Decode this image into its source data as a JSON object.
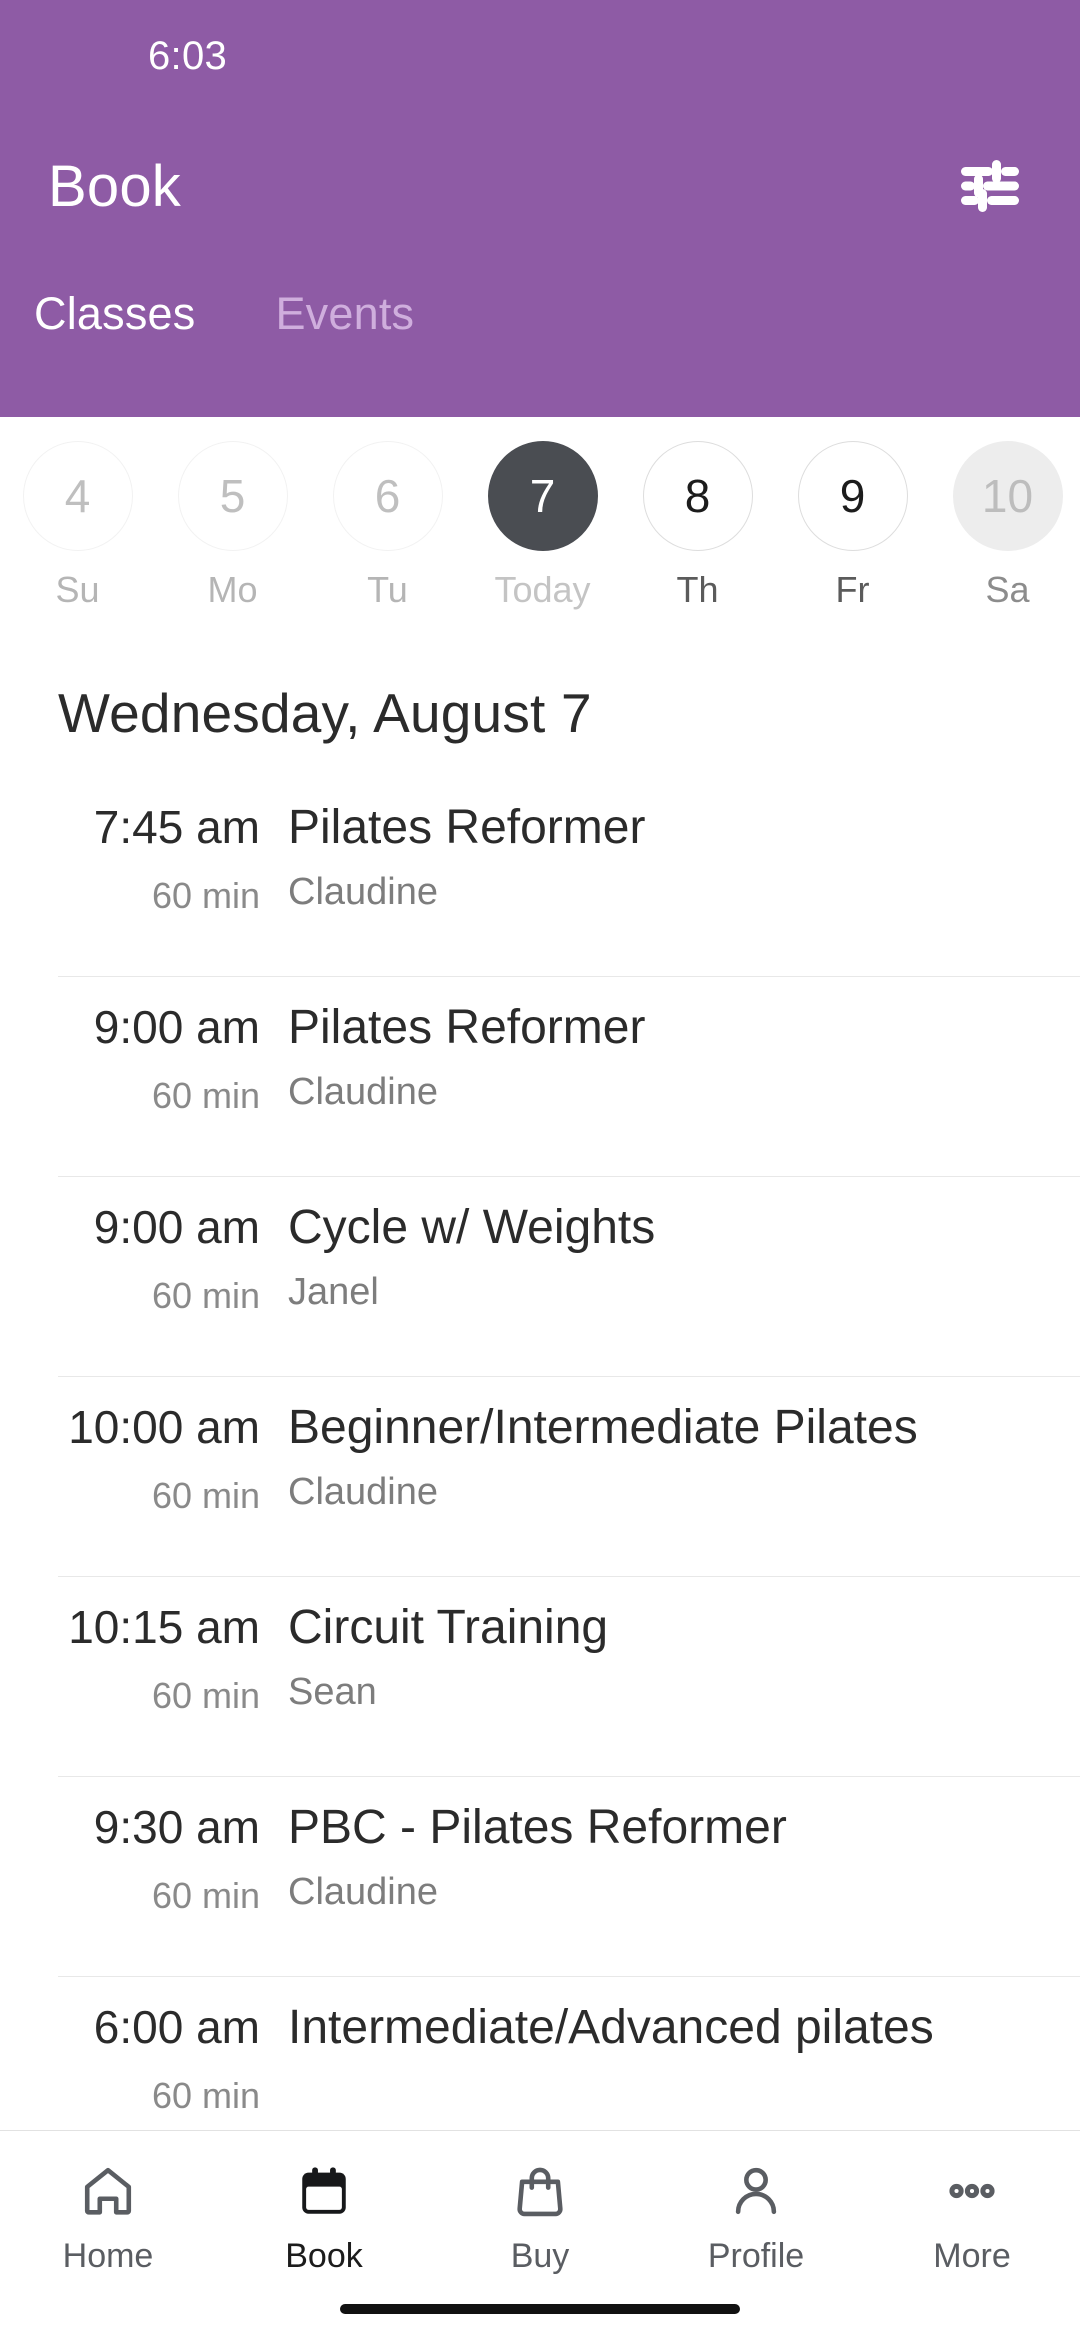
{
  "status_bar": {
    "time": "6:03"
  },
  "header": {
    "title": "Book",
    "filter_icon": "sliders-filter-icon",
    "accent_color": "#8E5BA5",
    "tabs": [
      {
        "label": "Classes",
        "active": true
      },
      {
        "label": "Events",
        "active": false
      }
    ]
  },
  "date_strip": {
    "days": [
      {
        "num": "4",
        "weekday": "Su",
        "state": "past"
      },
      {
        "num": "5",
        "weekday": "Mo",
        "state": "past"
      },
      {
        "num": "6",
        "weekday": "Tu",
        "state": "past"
      },
      {
        "num": "7",
        "weekday": "Today",
        "state": "selected"
      },
      {
        "num": "8",
        "weekday": "Th",
        "state": "future"
      },
      {
        "num": "9",
        "weekday": "Fr",
        "state": "future"
      },
      {
        "num": "10",
        "weekday": "Sa",
        "state": "faded"
      }
    ],
    "selected_color": "#4A4D52"
  },
  "date_heading": "Wednesday, August 7",
  "classes": [
    {
      "time": "7:45 am",
      "duration": "60 min",
      "name": "Pilates Reformer",
      "staff": "Claudine"
    },
    {
      "time": "9:00 am",
      "duration": "60 min",
      "name": "Pilates Reformer",
      "staff": "Claudine"
    },
    {
      "time": "9:00 am",
      "duration": "60 min",
      "name": "Cycle w/ Weights",
      "staff": "Janel"
    },
    {
      "time": "10:00 am",
      "duration": "60 min",
      "name": "Beginner/Intermediate Pilates",
      "staff": "Claudine"
    },
    {
      "time": "10:15 am",
      "duration": "60 min",
      "name": "Circuit Training",
      "staff": "Sean"
    },
    {
      "time": "9:30 am",
      "duration": "60 min",
      "name": "PBC - Pilates Reformer",
      "staff": "Claudine"
    },
    {
      "time": "6:00 am",
      "duration": "60 min",
      "name": "Intermediate/Advanced pilates",
      "staff": ""
    }
  ],
  "bottom_nav": [
    {
      "label": "Home",
      "icon": "home-icon",
      "active": false
    },
    {
      "label": "Book",
      "icon": "calendar-icon",
      "active": true
    },
    {
      "label": "Buy",
      "icon": "bag-icon",
      "active": false
    },
    {
      "label": "Profile",
      "icon": "person-icon",
      "active": false
    },
    {
      "label": "More",
      "icon": "dots-icon",
      "active": false
    }
  ]
}
